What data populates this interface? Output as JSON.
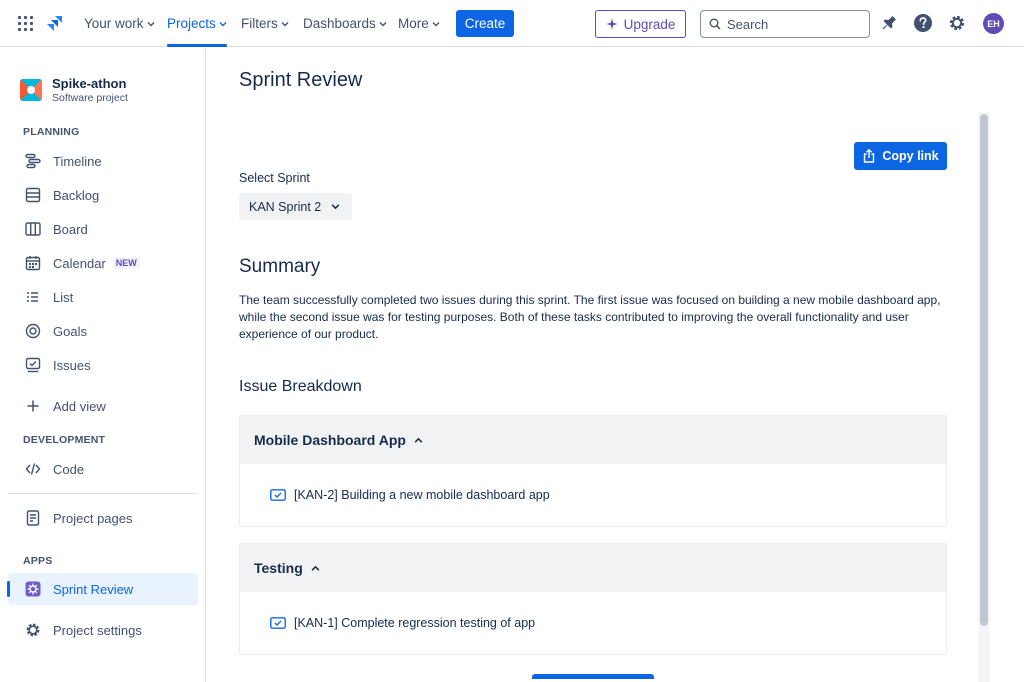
{
  "topnav": {
    "your_work": "Your work",
    "projects": "Projects",
    "filters": "Filters",
    "dashboards": "Dashboards",
    "more": "More",
    "create": "Create",
    "upgrade": "Upgrade",
    "search_placeholder": "Search",
    "avatar_initials": "EH"
  },
  "sidebar": {
    "project_name": "Spike-athon",
    "project_type": "Software project",
    "planning_label": "PLANNING",
    "timeline": "Timeline",
    "backlog": "Backlog",
    "board": "Board",
    "calendar": "Calendar",
    "calendar_badge": "NEW",
    "list": "List",
    "goals": "Goals",
    "issues": "Issues",
    "add_view": "Add view",
    "development_label": "DEVELOPMENT",
    "code": "Code",
    "project_pages": "Project pages",
    "apps_label": "APPS",
    "sprint_review": "Sprint Review",
    "project_settings": "Project settings"
  },
  "main": {
    "title": "Sprint Review",
    "copy_link": "Copy link",
    "select_sprint_label": "Select Sprint",
    "selected_sprint": "KAN Sprint 2",
    "summary_heading": "Summary",
    "summary_text": "The team successfully completed two issues during this sprint. The first issue was focused on building a new mobile dashboard app, while the second issue was for testing purposes. Both of these tasks contributed to improving the overall functionality and user experience of our product.",
    "breakdown_heading": "Issue Breakdown",
    "groups": [
      {
        "title": "Mobile Dashboard App",
        "issue": "[KAN-2] Building a new mobile dashboard app"
      },
      {
        "title": "Testing",
        "issue": "[KAN-1] Complete regression testing of app"
      }
    ]
  },
  "colors": {
    "brand_blue": "#0c66e4",
    "upgrade_purple": "#5e4db2",
    "text": "#172b4d"
  }
}
